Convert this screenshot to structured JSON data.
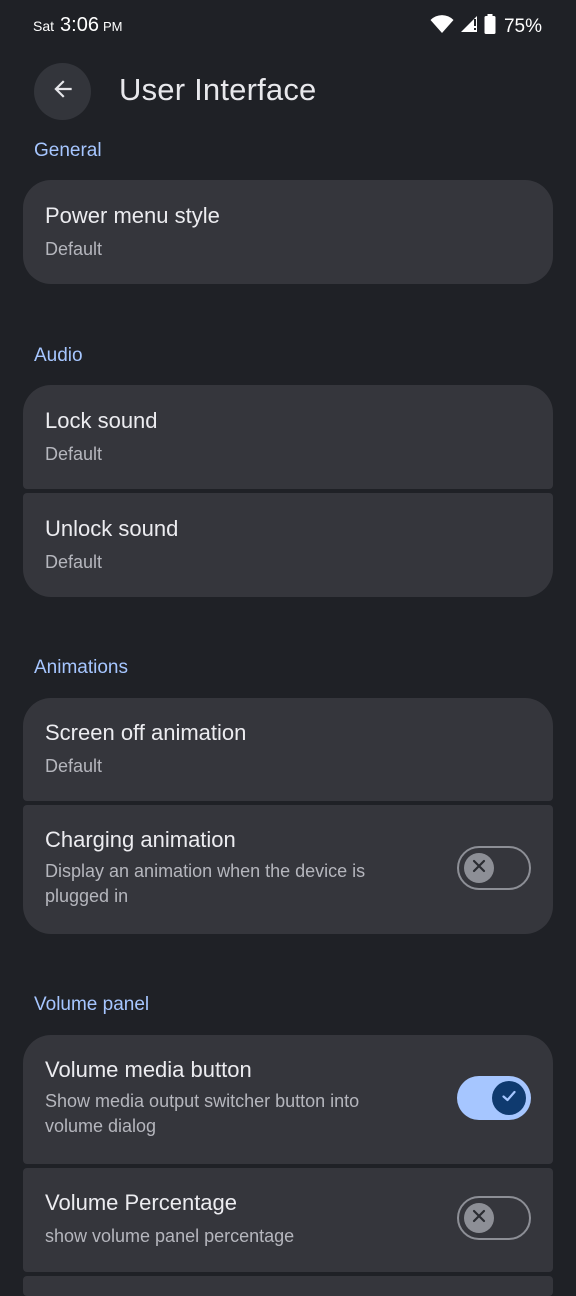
{
  "status_bar": {
    "day": "Sat",
    "time": "3:06",
    "ampm": "PM",
    "battery": "75%",
    "icons": [
      "wifi-icon",
      "signal-icon",
      "battery-icon"
    ]
  },
  "header": {
    "title": "User Interface",
    "back_icon": "arrow-back-icon"
  },
  "sections": {
    "general": {
      "title": "General",
      "items": [
        {
          "title": "Power menu style",
          "subtitle": "Default"
        }
      ]
    },
    "audio": {
      "title": "Audio",
      "items": [
        {
          "title": "Lock sound",
          "subtitle": "Default"
        },
        {
          "title": "Unlock sound",
          "subtitle": "Default"
        }
      ]
    },
    "animations": {
      "title": "Animations",
      "items": [
        {
          "title": "Screen off animation",
          "subtitle": "Default"
        },
        {
          "title": "Charging animation",
          "subtitle": "Display an animation when the device is plugged in",
          "toggle": false
        }
      ]
    },
    "volume_panel": {
      "title": "Volume panel",
      "items": [
        {
          "title": "Volume media button",
          "subtitle": "Show media output switcher button into volume dialog",
          "toggle": true
        },
        {
          "title": "Volume Percentage",
          "subtitle": "show volume panel percentage",
          "toggle": false
        }
      ]
    }
  },
  "colors": {
    "background": "#1f2126",
    "card": "#35363c",
    "accent": "#a6c6ff",
    "toggle_on_knob": "#0f3a6f"
  }
}
